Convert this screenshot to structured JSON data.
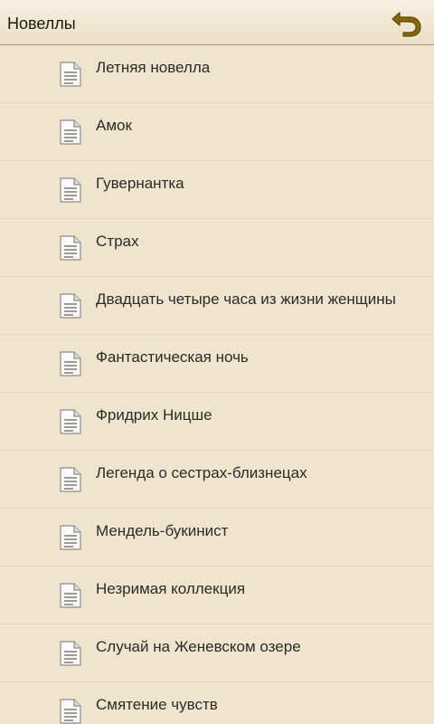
{
  "header": {
    "title": "Новеллы",
    "back_icon": "undo-arrow-icon",
    "back_icon_color": "#8a6a00"
  },
  "list": {
    "item_icon": "document-icon",
    "items": [
      {
        "label": "Летняя новелла"
      },
      {
        "label": "Амок"
      },
      {
        "label": "Гувернантка"
      },
      {
        "label": "Страх"
      },
      {
        "label": "Двадцать четыре часа из жизни женщины"
      },
      {
        "label": "Фантастическая ночь"
      },
      {
        "label": "Фридрих Ницше"
      },
      {
        "label": "Легенда о сестрах-близнецах"
      },
      {
        "label": "Мендель-букинист"
      },
      {
        "label": "Незримая коллекция"
      },
      {
        "label": "Случай на Женевском озере"
      },
      {
        "label": "Смятение чувств"
      }
    ]
  },
  "colors": {
    "background": "#efe4cd",
    "divider": "#e1d5bb",
    "text": "#2b2b2b"
  }
}
